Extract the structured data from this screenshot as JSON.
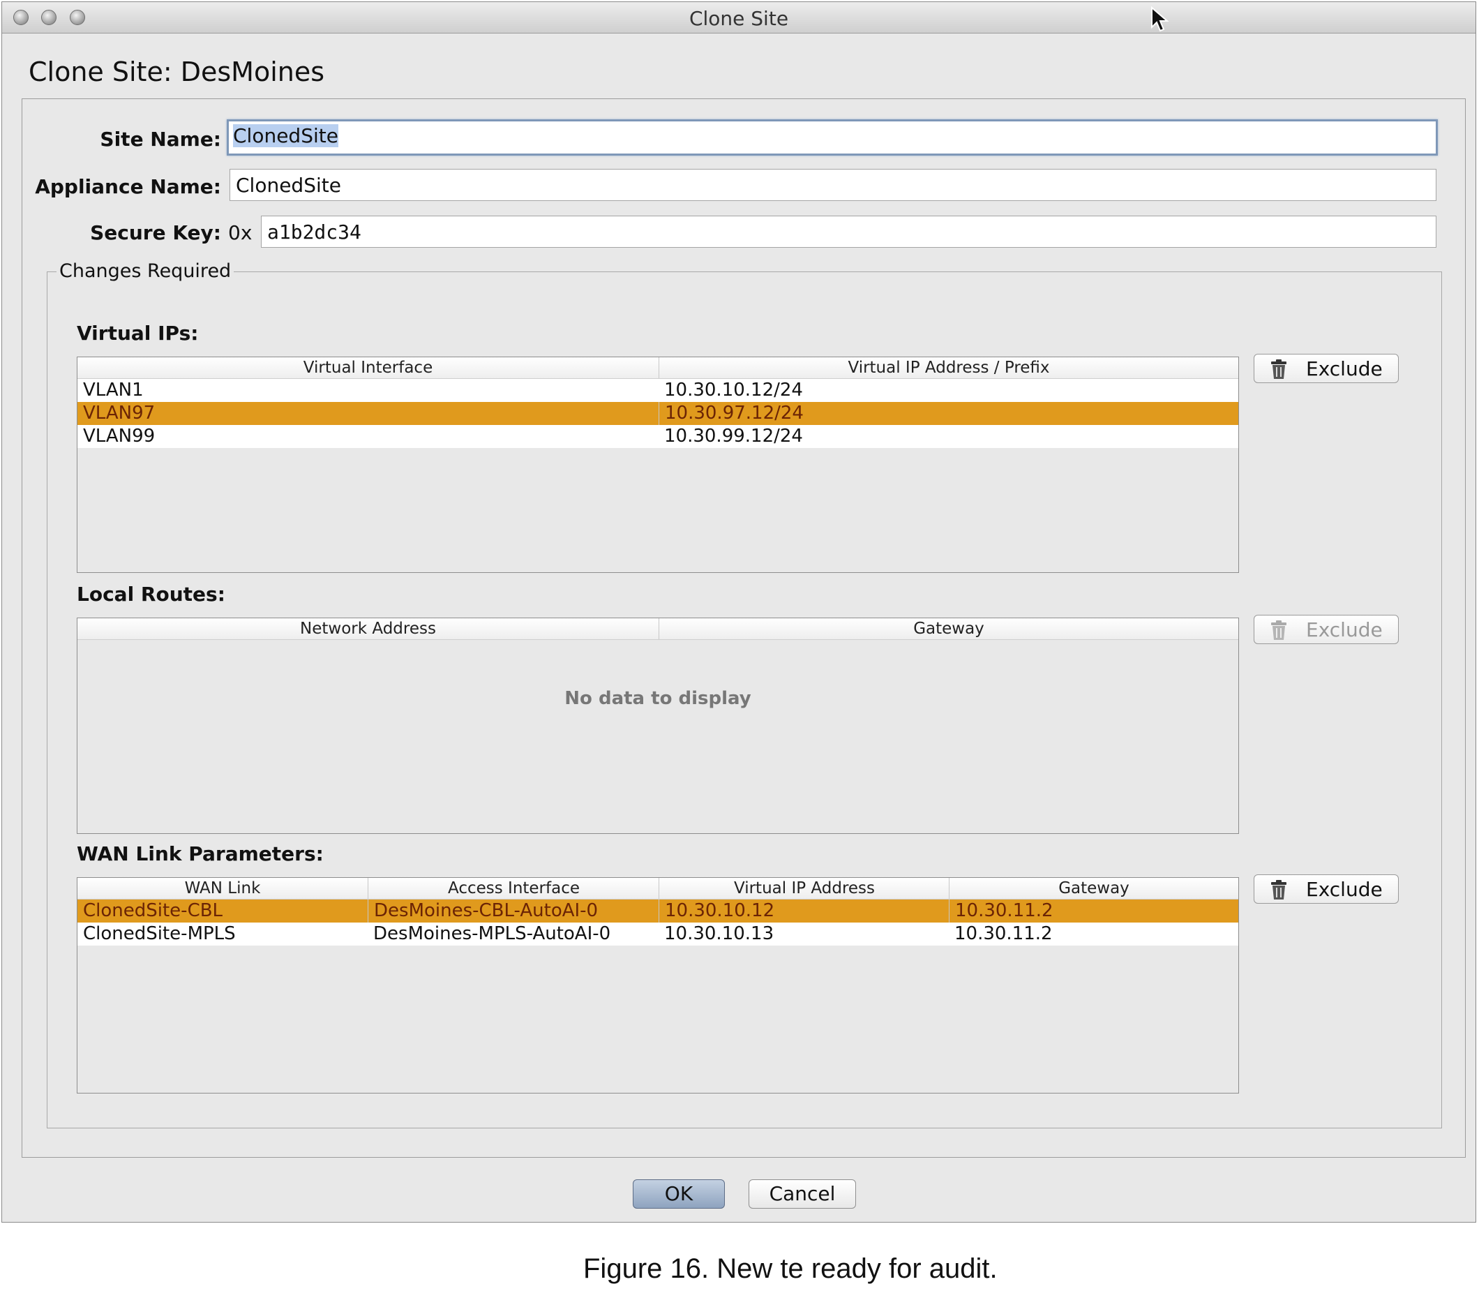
{
  "window": {
    "title": "Clone Site"
  },
  "dialog": {
    "heading": "Clone Site: DesMoines"
  },
  "form": {
    "site_name_label": "Site Name:",
    "site_name_value": "ClonedSite",
    "appliance_name_label": "Appliance Name:",
    "appliance_name_value": "ClonedSite",
    "secure_key_label": "Secure Key:",
    "secure_key_prefix": "0x",
    "secure_key_value": "a1b2dc34"
  },
  "changes": {
    "group_title": "Changes Required",
    "virtual_ips": {
      "label": "Virtual IPs:",
      "columns": [
        "Virtual Interface",
        "Virtual IP Address / Prefix"
      ],
      "rows": [
        {
          "interface": "VLAN1",
          "address": "10.30.10.12/24",
          "selected": false
        },
        {
          "interface": "VLAN97",
          "address": "10.30.97.12/24",
          "selected": true
        },
        {
          "interface": "VLAN99",
          "address": "10.30.99.12/24",
          "selected": false
        }
      ],
      "exclude_label": "Exclude"
    },
    "local_routes": {
      "label": "Local Routes:",
      "columns": [
        "Network Address",
        "Gateway"
      ],
      "empty_text": "No data to display",
      "exclude_label": "Exclude",
      "exclude_enabled": false
    },
    "wan_links": {
      "label": "WAN Link Parameters:",
      "columns": [
        "WAN Link",
        "Access Interface",
        "Virtual IP Address",
        "Gateway"
      ],
      "rows": [
        {
          "link": "ClonedSite-CBL",
          "access": "DesMoines-CBL-AutoAI-0",
          "vip": "10.30.10.12",
          "gateway": "10.30.11.2",
          "selected": true
        },
        {
          "link": "ClonedSite-MPLS",
          "access": "DesMoines-MPLS-AutoAI-0",
          "vip": "10.30.10.13",
          "gateway": "10.30.11.2",
          "selected": false
        }
      ],
      "exclude_label": "Exclude"
    }
  },
  "buttons": {
    "ok": "OK",
    "cancel": "Cancel"
  },
  "caption": "Figure 16. New    te ready for audit.",
  "colors": {
    "selection_row": "#e09a1d",
    "text_selection": "#b8cff0",
    "ok_button": "#8ea3bf"
  }
}
